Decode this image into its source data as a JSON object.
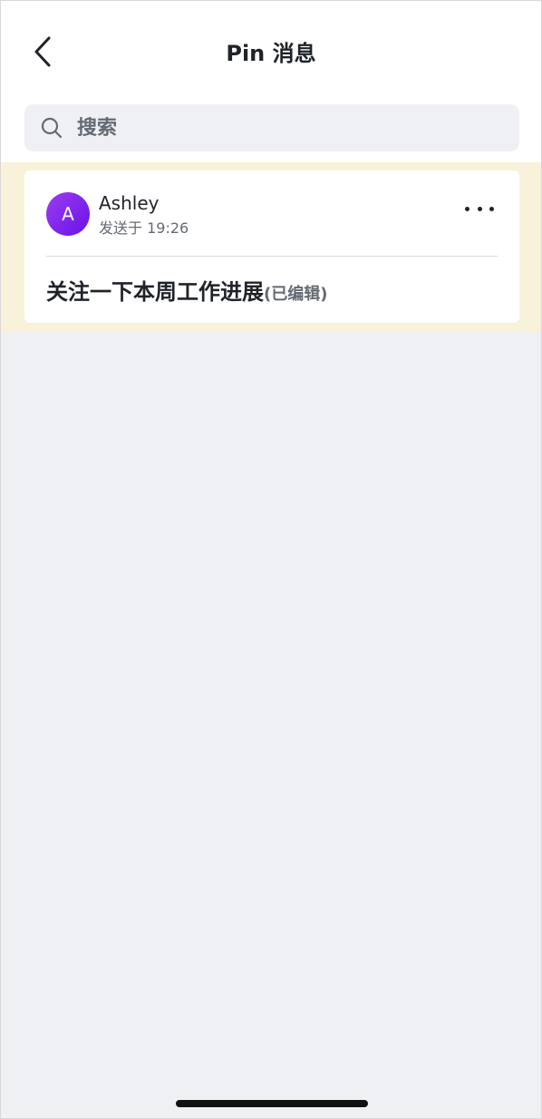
{
  "header": {
    "title": "Pin 消息",
    "back_icon": "chevron-left-icon"
  },
  "search": {
    "placeholder": "搜索",
    "icon": "search-icon"
  },
  "pinned_messages": [
    {
      "avatar_initial": "A",
      "author": "Ashley",
      "sent_time": "发送于 19:26",
      "text": "关注一下本周工作进展",
      "edited_label": "(已编辑)"
    }
  ],
  "colors": {
    "pin_highlight": "#f8f2da",
    "avatar_gradient_start": "#9b3cf0",
    "avatar_gradient_end": "#6a12e8",
    "background": "#eef0f4"
  }
}
